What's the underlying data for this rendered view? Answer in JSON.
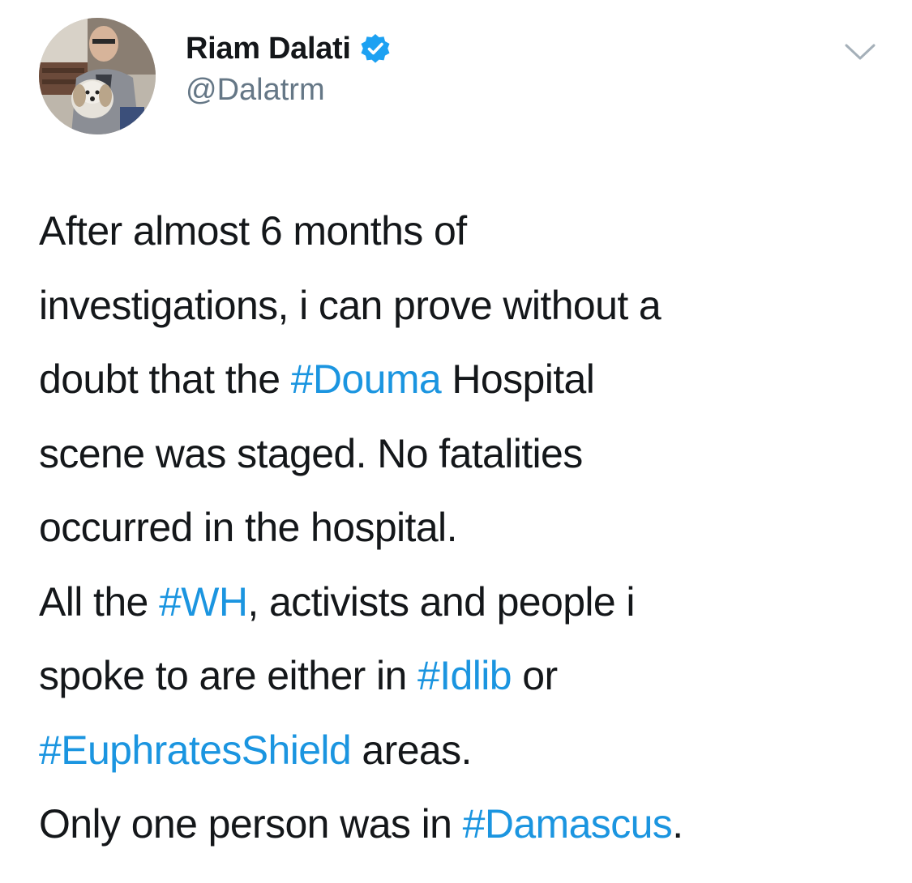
{
  "author": {
    "display_name": "Riam Dalati",
    "handle": "@Dalatrm",
    "verified": true
  },
  "menu": {
    "icon": "chevron-down-icon"
  },
  "colors": {
    "text": "#14171a",
    "secondary": "#657786",
    "link": "#1b95e0",
    "verified_badge": "#1da1f2"
  },
  "tweet": {
    "lines": [
      [
        {
          "text": "After almost 6 months of"
        }
      ],
      [
        {
          "text": "investigations, i can prove without a"
        }
      ],
      [
        {
          "text": "doubt that the "
        },
        {
          "text": "#Douma",
          "hashtag": true
        },
        {
          "text": " Hospital"
        }
      ],
      [
        {
          "text": "scene was staged. No fatalities"
        }
      ],
      [
        {
          "text": "occurred in the hospital."
        }
      ],
      [
        {
          "text": "All the "
        },
        {
          "text": "#WH",
          "hashtag": true
        },
        {
          "text": ", activists and people i"
        }
      ],
      [
        {
          "text": "spoke to are either in "
        },
        {
          "text": "#Idlib",
          "hashtag": true
        },
        {
          "text": " or"
        }
      ],
      [
        {
          "text": "#EuphratesShield",
          "hashtag": true
        },
        {
          "text": " areas."
        }
      ],
      [
        {
          "text": "Only one person was in "
        },
        {
          "text": "#Damascus",
          "hashtag": true
        },
        {
          "text": "."
        }
      ]
    ]
  }
}
